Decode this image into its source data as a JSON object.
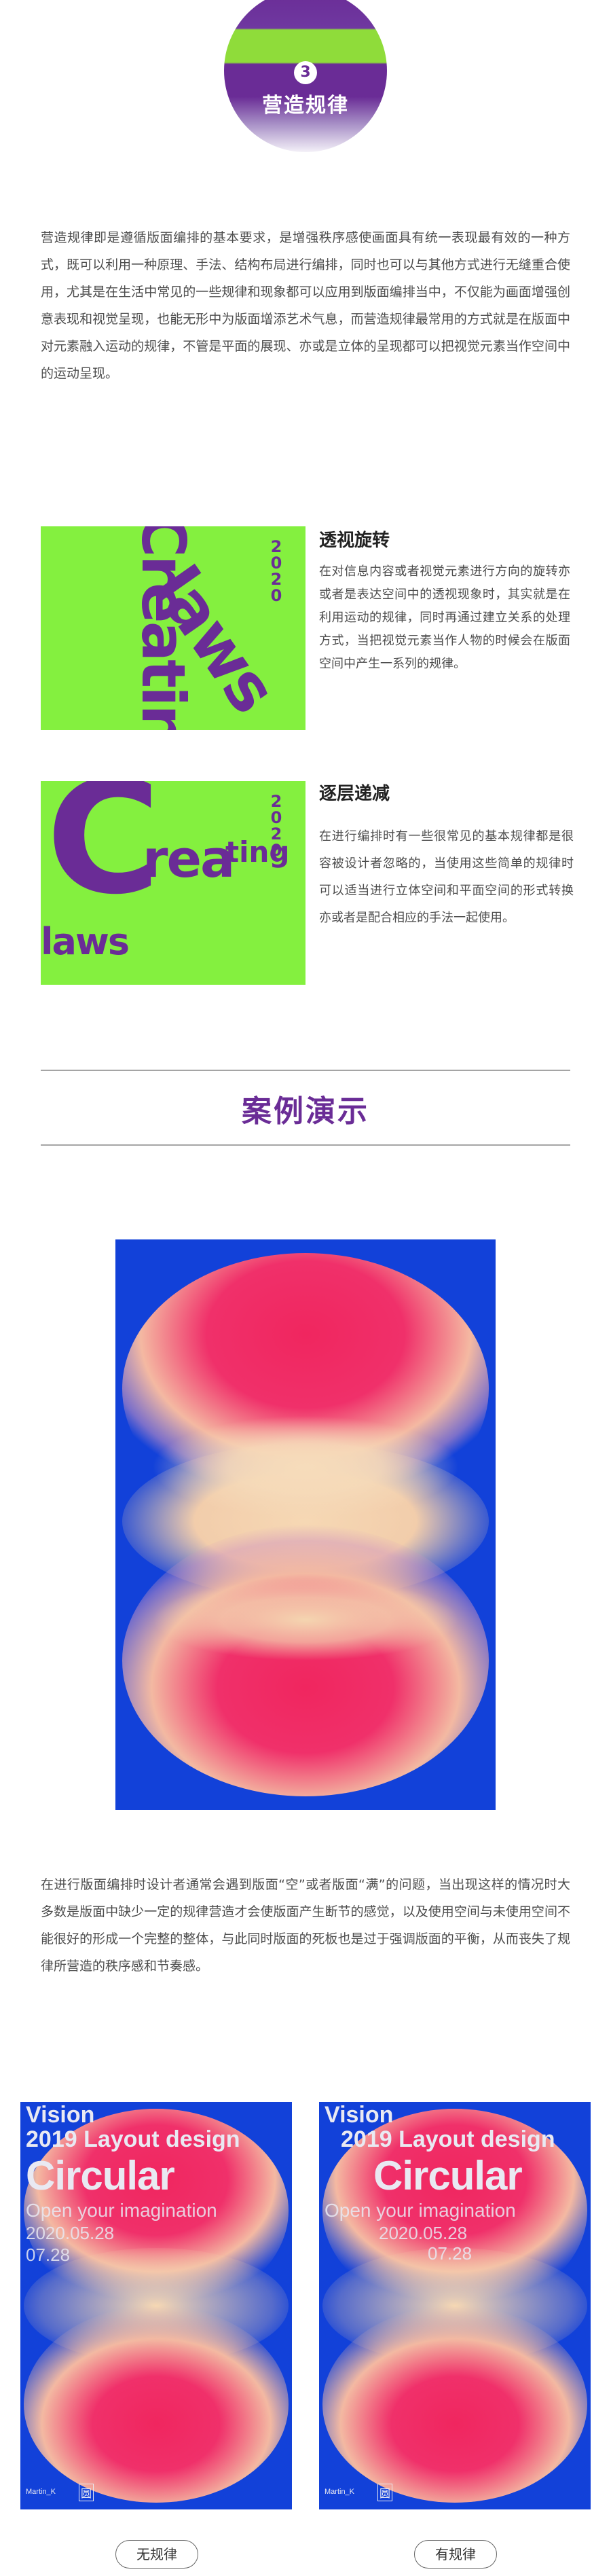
{
  "section": {
    "number": "3",
    "title": "营造规律"
  },
  "intro": "营造规律即是遵循版面编排的基本要求，是增强秩序感使画面具有统一表现最有效的一种方式，既可以利用一种原理、手法、结构布局进行编排，同时也可以与其他方式进行无缝重合使用，尤其是在生活中常见的一些规律和现象都可以应用到版面编排当中，不仅能为画面增强创意表现和视觉呈现，也能无形中为版面增添艺术气息，而营造规律最常用的方式就是在版面中对元素融入运动的规律，不管是平面的展现、亦或是立体的呈现都可以把视觉元素当作空间中的运动呈现。",
  "card1": {
    "title": "透视旋转",
    "text": "在对信息内容或者视觉元素进行方向的旋转亦或者是表达空间中的透视现象时，其实就是在利用运动的规律，同时再通过建立关系的处理方式，当把视觉元素当作人物的时候会在版面空间中产生一系列的规律。",
    "poster_word1": "Creating",
    "poster_word2": "laws",
    "year": "2020"
  },
  "card2": {
    "title": "逐层递减",
    "text": "在进行编排时有一些很常见的基本规律都是很容被设计者忽略的，当使用这些简单的规律时可以适当进行立体空间和平面空间的形式转换亦或者是配合相应的手法一起使用。",
    "poster_big": "C",
    "poster_rea": "rea",
    "poster_ting": "ting",
    "poster_laws": "laws",
    "year": "2020"
  },
  "case": {
    "title": "案例演示"
  },
  "case_text": "在进行版面编排时设计者通常会遇到版面“空”或者版面“满”的问题，当出现这样的情况时大多数是版面中缺少一定的规律营造才会使版面产生断节的感觉，以及使用空间与未使用空间不能很好的形成一个完整的整体，与此同时版面的死板也是过于强调版面的平衡，从而丧失了规律所营造的秩序感和节奏感。",
  "poster_a": {
    "line1": "Vision",
    "line2": "2019 Layout design",
    "line3": "Circular",
    "line4": "Open your imagination",
    "date1": "2020.05.28",
    "date2": "07.28",
    "author": "Martin_K",
    "mark": "圆",
    "caption": "无规律"
  },
  "poster_b": {
    "line1": "Vision",
    "line2": "2019 Layout design",
    "line3": "Circular",
    "line4": "Open your imagination",
    "date1": "2020.05.28",
    "date2": "07.28",
    "author": "Martin_K",
    "mark": "圆",
    "caption": "有规律"
  },
  "colors": {
    "purple": "#6a2c96",
    "green": "#84f03f",
    "blue": "#1241d9",
    "pink": "#ef2f67",
    "cream": "#f3d2ae"
  }
}
